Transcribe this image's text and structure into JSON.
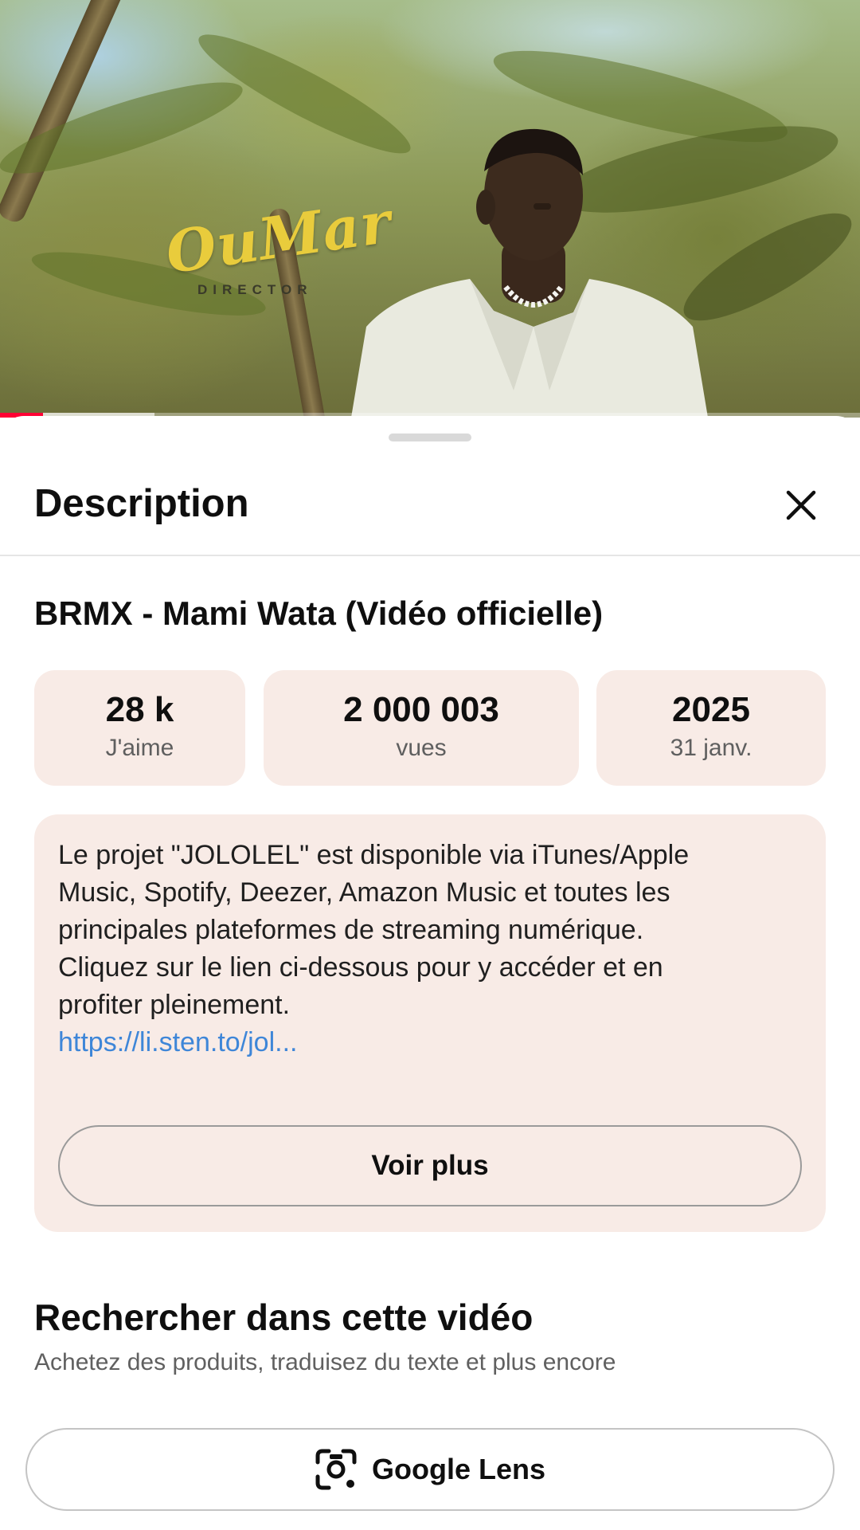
{
  "video": {
    "watermark": {
      "script": "OuMar",
      "subtitle": "DIRECTOR"
    },
    "progress": {
      "played_fraction": 0.05,
      "buffered_fraction": 0.18
    }
  },
  "sheet": {
    "title": "Description",
    "close_icon": "close-icon"
  },
  "video_title": "BRMX - Mami Wata (Vidéo officielle)",
  "stats": [
    {
      "value": "28 k",
      "label": "J'aime"
    },
    {
      "value": "2 000 003",
      "label": "vues"
    },
    {
      "value": "2025",
      "label": "31 janv."
    }
  ],
  "description": {
    "lines": [
      "Le projet  \"JOLOLEL\" est disponible via iTunes/Apple",
      "Music, Spotify, Deezer, Amazon Music et toutes les",
      "principales plateformes de streaming numérique.",
      "Cliquez sur le lien ci-dessous pour y accéder et en",
      "profiter pleinement."
    ],
    "link": "https://li.sten.to/jol...",
    "more_button": "Voir plus"
  },
  "search": {
    "title": "Rechercher dans cette vidéo",
    "subtitle": "Achetez des produits, traduisez du texte et plus encore",
    "lens_button": "Google Lens",
    "lens_icon": "google-lens-icon"
  },
  "colors": {
    "accent_red": "#ff0033",
    "card_bg": "#f8ebe6",
    "link": "#3e86d8",
    "logo_gold": "#e9cc3c"
  }
}
